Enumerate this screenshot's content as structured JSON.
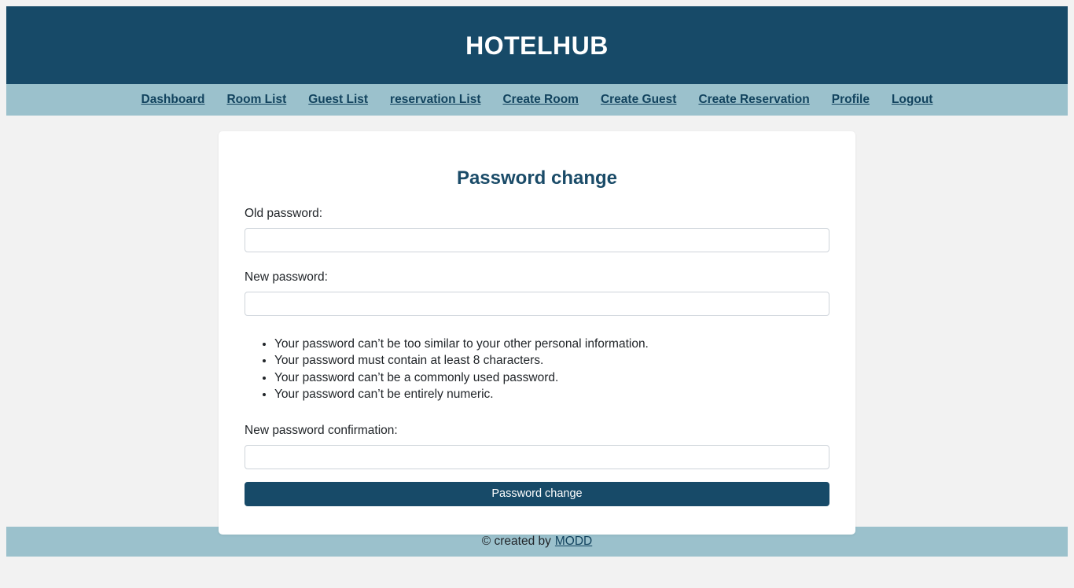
{
  "header": {
    "title": "HOTELHUB",
    "background_color": "#174a68",
    "title_color": "#ffffff"
  },
  "nav": {
    "background_color": "#9bc1cc",
    "link_color": "#12435e",
    "items": [
      {
        "label": "Dashboard"
      },
      {
        "label": "Room List"
      },
      {
        "label": "Guest List"
      },
      {
        "label": "reservation List"
      },
      {
        "label": "Create Room"
      },
      {
        "label": "Create Guest"
      },
      {
        "label": "Create Reservation"
      },
      {
        "label": "Profile"
      },
      {
        "label": "Logout"
      }
    ]
  },
  "card": {
    "title": "Password change",
    "title_color": "#1a4b68",
    "fields": [
      {
        "label": "Old password:",
        "value": "",
        "placeholder": ""
      },
      {
        "label": "New password:",
        "value": "",
        "placeholder": ""
      },
      {
        "label": "New password confirmation:",
        "value": "",
        "placeholder": ""
      }
    ],
    "password_help": [
      "Your password can’t be too similar to your other personal information.",
      "Your password must contain at least 8 characters.",
      "Your password can’t be a commonly used password.",
      "Your password can’t be entirely numeric."
    ],
    "submit_label": "Password change",
    "submit_color": "#174a68"
  },
  "footer": {
    "background_color": "#9bc1cc",
    "text": "© created by",
    "link_label": "MODD"
  }
}
